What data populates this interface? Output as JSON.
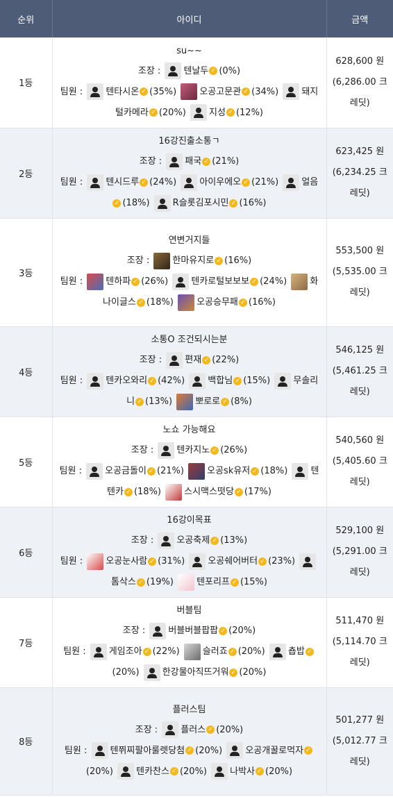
{
  "header": {
    "rank": "순위",
    "id": "아이디",
    "amount": "금액"
  },
  "labels": {
    "leader": "조장 : ",
    "members": "팀원 : "
  },
  "colors": {
    "header_bg": "#4f5c77",
    "row_even": "#eef1f6",
    "verified": "#f3b81c"
  },
  "icons": {
    "verified": "verified-badge-icon",
    "default_avatar": "person-icon"
  },
  "rows": [
    {
      "rank": "1등",
      "team": "su~~",
      "leader": {
        "name": "텐날두",
        "pct": "(0%)",
        "avatar": "person"
      },
      "members": [
        {
          "name": "텐타시온",
          "pct": "(35%)",
          "avatar": "person"
        },
        {
          "name": "오공고문관",
          "pct": "(34%)",
          "avatar": "pic",
          "colors": [
            "#c05b7a",
            "#6d2b3e"
          ]
        },
        {
          "name": "돼지털카메라",
          "pct": "(20%)",
          "avatar": "person"
        },
        {
          "name": "지성",
          "pct": "(12%)",
          "avatar": "person"
        }
      ],
      "amount": "628,600 원",
      "credit": "(6,286.00 크레딧)"
    },
    {
      "rank": "2등",
      "team": "16강진출소통ㄱ",
      "leader": {
        "name": "패국",
        "pct": "(21%)",
        "avatar": "person"
      },
      "members": [
        {
          "name": "텐시드루",
          "pct": "(24%)",
          "avatar": "person"
        },
        {
          "name": "아이우에오",
          "pct": "(21%)",
          "avatar": "person"
        },
        {
          "name": "얼음",
          "pct": "(18%)",
          "avatar": "person"
        },
        {
          "name": "R슬롯김포시민",
          "pct": "(16%)",
          "avatar": "person"
        }
      ],
      "amount": "623,425 원",
      "credit": "(6,234.25 크레딧)"
    },
    {
      "rank": "3등",
      "team": "연변거지들",
      "leader": {
        "name": "한마유지로",
        "pct": "(16%)",
        "avatar": "pic",
        "colors": [
          "#8a6a3a",
          "#2f2418"
        ]
      },
      "members": [
        {
          "name": "텐하파",
          "pct": "(26%)",
          "avatar": "pic",
          "colors": [
            "#d94b4b",
            "#4a6fb8"
          ]
        },
        {
          "name": "텐카로털보보보",
          "pct": "(24%)",
          "avatar": "person"
        },
        {
          "name": "화나이글스",
          "pct": "(18%)",
          "avatar": "pic",
          "colors": [
            "#d9b27a",
            "#8b6c4a"
          ]
        },
        {
          "name": "오공승무패",
          "pct": "(16%)",
          "avatar": "pic",
          "colors": [
            "#6b4fb5",
            "#c98a3a"
          ]
        }
      ],
      "amount": "553,500 원",
      "credit": "(5,535.00 크레딧)"
    },
    {
      "rank": "4등",
      "team": "소통O 조건되시는분",
      "leader": {
        "name": "편재",
        "pct": "(22%)",
        "avatar": "person"
      },
      "members": [
        {
          "name": "텐카오와리",
          "pct": "(42%)",
          "avatar": "person"
        },
        {
          "name": "백합님",
          "pct": "(15%)",
          "avatar": "person"
        },
        {
          "name": "무솔리니",
          "pct": "(13%)",
          "avatar": "person"
        },
        {
          "name": "뽀로로",
          "pct": "(8%)",
          "avatar": "pic",
          "colors": [
            "#e07a2e",
            "#3a6ab8"
          ]
        }
      ],
      "amount": "546,125 원",
      "credit": "(5,461.25 크레딧)"
    },
    {
      "rank": "5등",
      "team": "노쇼 가능해요",
      "leader": {
        "name": "텐카지노",
        "pct": "(26%)",
        "avatar": "person"
      },
      "members": [
        {
          "name": "오공금돌이",
          "pct": "(21%)",
          "avatar": "person"
        },
        {
          "name": "오공sk유저",
          "pct": "(18%)",
          "avatar": "pic",
          "colors": [
            "#a03a3a",
            "#2f3f6a"
          ]
        },
        {
          "name": "텐텐카",
          "pct": "(18%)",
          "avatar": "person"
        },
        {
          "name": "스시맥스떳당",
          "pct": "(17%)",
          "avatar": "pic",
          "colors": [
            "#ffffff",
            "#c23a3a"
          ]
        }
      ],
      "amount": "540,560 원",
      "credit": "(5,405.60 크레딧)"
    },
    {
      "rank": "6등",
      "team": "16강이목표",
      "leader": {
        "name": "오공축제",
        "pct": "(13%)",
        "avatar": "person"
      },
      "members": [
        {
          "name": "오공눈사람",
          "pct": "(31%)",
          "avatar": "pic",
          "colors": [
            "#ffffff",
            "#d84a4a"
          ]
        },
        {
          "name": "오공쉐어버터",
          "pct": "(23%)",
          "avatar": "person"
        },
        {
          "name": "톰삭스",
          "pct": "(19%)",
          "avatar": "person"
        },
        {
          "name": "텐포리프",
          "pct": "(15%)",
          "avatar": "pic",
          "colors": [
            "#ffffff",
            "#f2c4d0"
          ]
        }
      ],
      "amount": "529,100 원",
      "credit": "(5,291.00 크레딧)"
    },
    {
      "rank": "7등",
      "team": "버블팀",
      "leader": {
        "name": "버블버블팝팝",
        "pct": "(20%)",
        "avatar": "person"
      },
      "members": [
        {
          "name": "게임조아",
          "pct": "(22%)",
          "avatar": "person"
        },
        {
          "name": "슬러죠",
          "pct": "(20%)",
          "avatar": "pic",
          "colors": [
            "#d8d8d8",
            "#6a6a6a"
          ]
        },
        {
          "name": "춉밥",
          "pct": "(20%)",
          "avatar": "person"
        },
        {
          "name": "한강물아직뜨거워",
          "pct": "(20%)",
          "avatar": "person"
        }
      ],
      "amount": "511,470 원",
      "credit": "(5,114.70 크레딧)"
    },
    {
      "rank": "8등",
      "team": "플러스팀",
      "leader": {
        "name": "플러스",
        "pct": "(20%)",
        "avatar": "person"
      },
      "members": [
        {
          "name": "텐쮜찌팔아룰렛당첨",
          "pct": "(20%)",
          "avatar": "person"
        },
        {
          "name": "오공개꿀로먹자",
          "pct": "(20%)",
          "avatar": "person"
        },
        {
          "name": "텐카찬스",
          "pct": "(20%)",
          "avatar": "person"
        },
        {
          "name": "나박사",
          "pct": "(20%)",
          "avatar": "person"
        }
      ],
      "amount": "501,277 원",
      "credit": "(5,012.77 크레딧)"
    }
  ]
}
